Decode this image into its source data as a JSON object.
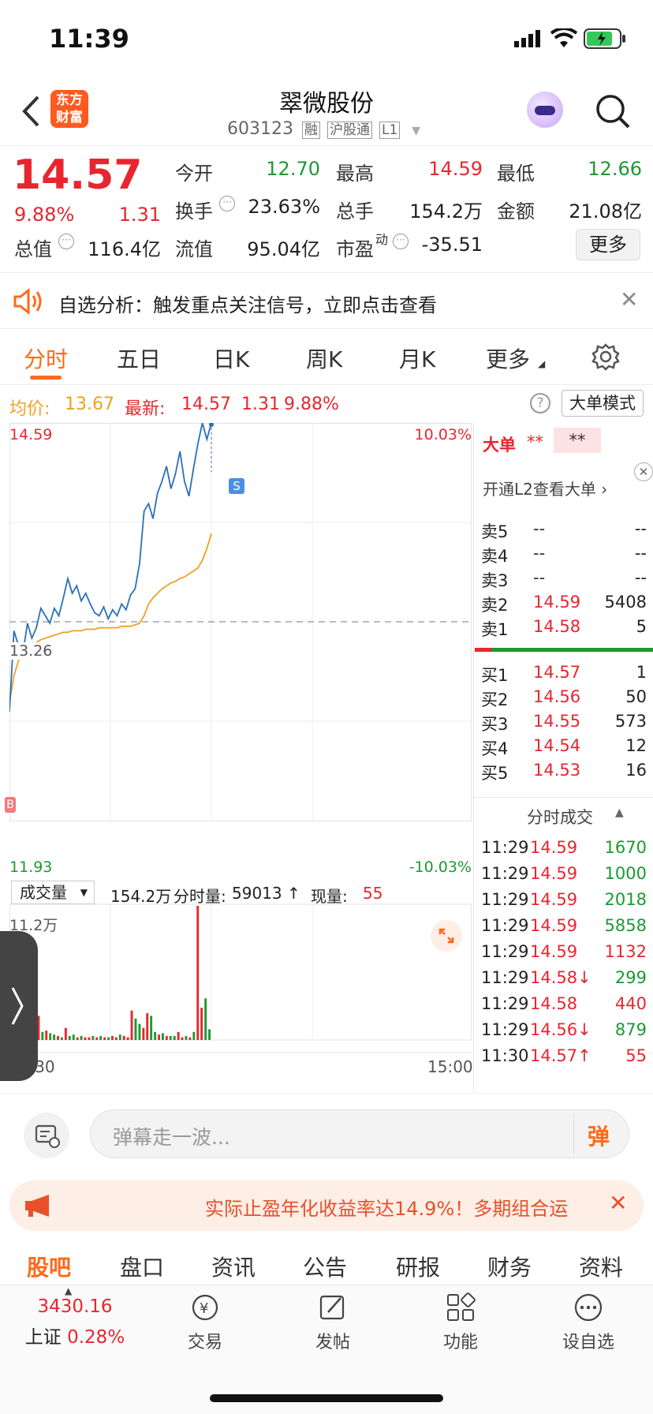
{
  "status": {
    "time": "11:39"
  },
  "nav": {
    "title": "翠微股份",
    "code": "603123",
    "tags": [
      "融",
      "沪股通",
      "L1"
    ],
    "logo_line1": "东方",
    "logo_line2": "财富"
  },
  "quote": {
    "price": "14.57",
    "pct": "9.88%",
    "chg": "1.31",
    "jinkai_label": "今开",
    "jinkai": "12.70",
    "zuigao_label": "最高",
    "zuigao": "14.59",
    "zuidi_label": "最低",
    "zuidi": "12.66",
    "huanshou_label": "换手",
    "huanshou": "23.63%",
    "zongshou_label": "总手",
    "zongshou": "154.2万",
    "jine_label": "金额",
    "jine": "21.08亿",
    "zongzhi_label": "总值",
    "zongzhi": "116.4亿",
    "liuzhi_label": "流值",
    "liuzhi": "95.04亿",
    "shiying_label": "市盈",
    "shiying_sup": "动",
    "shiying": "-35.51",
    "more_btn": "更多"
  },
  "alert": {
    "text": "自选分析：触发重点关注信号，立即点击查看"
  },
  "tabs": {
    "items": [
      "分时",
      "五日",
      "日K",
      "周K",
      "月K",
      "更多"
    ],
    "active": 0
  },
  "avgline": {
    "avg_label": "均价:",
    "avg": "13.67",
    "latest_label": "最新:",
    "latest": "14.57",
    "chg": "1.31",
    "pct": "9.88%",
    "mode_btn": "大单模式"
  },
  "chart_data": {
    "type": "line",
    "ylim": [
      11.93,
      14.59
    ],
    "y_top_label": "14.59",
    "y_bottom_label": "11.93",
    "y_mid_label": "13.26",
    "pct_top_label": "10.03%",
    "pct_bottom_label": "-10.03%",
    "x_start_label": "09:30",
    "x_end_label": "15:00",
    "s_marker": "S",
    "b_marker": "B",
    "series": [
      {
        "values": [
          12.66,
          13.2,
          13.1,
          13.05,
          13.25,
          13.15,
          13.22,
          13.35,
          13.3,
          13.25,
          13.35,
          13.3,
          13.42,
          13.55,
          13.45,
          13.5,
          13.4,
          13.45,
          13.38,
          13.32,
          13.3,
          13.36,
          13.28,
          13.34,
          13.3,
          13.38,
          13.34,
          13.44,
          13.48,
          13.65,
          14.0,
          14.05,
          13.95,
          14.12,
          14.2,
          14.3,
          14.15,
          14.25,
          14.4,
          14.2,
          14.1,
          14.28,
          14.45,
          14.59,
          14.48,
          14.59
        ]
      },
      {
        "values": [
          12.72,
          12.9,
          13.0,
          13.05,
          13.08,
          13.1,
          13.12,
          13.14,
          13.15,
          13.16,
          13.17,
          13.18,
          13.19,
          13.19,
          13.2,
          13.2,
          13.2,
          13.21,
          13.21,
          13.21,
          13.22,
          13.22,
          13.22,
          13.22,
          13.22,
          13.23,
          13.23,
          13.23,
          13.24,
          13.25,
          13.3,
          13.38,
          13.42,
          13.45,
          13.48,
          13.5,
          13.52,
          13.53,
          13.55,
          13.56,
          13.58,
          13.6,
          13.62,
          13.67,
          13.75,
          13.85
        ]
      }
    ],
    "volume": {
      "selector_label": "成交量",
      "total": "154.2万",
      "fenshi_label": "分时量:",
      "fenshi": "59013 ↑",
      "xian_label": "现量:",
      "xian": "55",
      "ymax_label": "11.2万",
      "values": [
        3,
        12,
        5,
        4,
        8,
        3,
        2,
        18,
        6,
        7,
        5,
        4,
        3,
        2,
        9,
        3,
        4,
        2,
        3,
        2,
        2,
        3,
        2,
        3,
        2,
        2,
        3,
        2,
        4,
        3,
        2,
        22,
        16,
        12,
        9,
        20,
        18,
        6,
        4,
        5,
        3,
        3,
        3,
        6,
        2,
        3,
        2,
        6,
        100,
        24,
        31,
        8
      ],
      "colors": [
        "red",
        "green",
        "green",
        "red",
        "green",
        "green",
        "green",
        "red",
        "green",
        "red",
        "green",
        "green",
        "red",
        "green",
        "red",
        "green",
        "green",
        "red",
        "green",
        "red",
        "red",
        "green",
        "red",
        "green",
        "red",
        "green",
        "red",
        "red",
        "green",
        "red",
        "red",
        "red",
        "green",
        "green",
        "red",
        "red",
        "green",
        "green",
        "red",
        "green",
        "red",
        "green",
        "green",
        "red",
        "red",
        "green",
        "red",
        "green",
        "red",
        "red",
        "green",
        "green"
      ]
    }
  },
  "orderbook": {
    "dadan_label": "大单",
    "dadan_val1": "**",
    "dadan_val2": "**",
    "l2_text": "开通L2查看大单 ›",
    "sell": [
      {
        "label": "卖5",
        "price": "--",
        "vol": "--"
      },
      {
        "label": "卖4",
        "price": "--",
        "vol": "--"
      },
      {
        "label": "卖3",
        "price": "--",
        "vol": "--"
      },
      {
        "label": "卖2",
        "price": "14.59",
        "vol": "5408"
      },
      {
        "label": "卖1",
        "price": "14.58",
        "vol": "5"
      }
    ],
    "buy": [
      {
        "label": "买1",
        "price": "14.57",
        "vol": "1"
      },
      {
        "label": "买2",
        "price": "14.56",
        "vol": "50"
      },
      {
        "label": "买3",
        "price": "14.55",
        "vol": "573"
      },
      {
        "label": "买4",
        "price": "14.54",
        "vol": "12"
      },
      {
        "label": "买5",
        "price": "14.53",
        "vol": "16"
      }
    ],
    "trades_title": "分时成交",
    "trades": [
      {
        "time": "11:29",
        "price": "14.59",
        "vol": "1670",
        "vcolor": "green"
      },
      {
        "time": "11:29",
        "price": "14.59",
        "vol": "1000",
        "vcolor": "green"
      },
      {
        "time": "11:29",
        "price": "14.59",
        "vol": "2018",
        "vcolor": "green"
      },
      {
        "time": "11:29",
        "price": "14.59",
        "vol": "5858",
        "vcolor": "green"
      },
      {
        "time": "11:29",
        "price": "14.59",
        "vol": "1132",
        "vcolor": "red"
      },
      {
        "time": "11:29",
        "price": "14.58↓",
        "vol": "299",
        "vcolor": "green"
      },
      {
        "time": "11:29",
        "price": "14.58",
        "vol": "440",
        "vcolor": "red"
      },
      {
        "time": "11:29",
        "price": "14.56↓",
        "vol": "879",
        "vcolor": "green"
      },
      {
        "time": "11:30",
        "price": "14.57↑",
        "vol": "55",
        "vcolor": "red"
      }
    ]
  },
  "chat": {
    "placeholder": "弹幕走一波...",
    "send_btn": "弹"
  },
  "banner": {
    "text": "实际止盈年化收益率达14.9%！多期组合运"
  },
  "subtabs": [
    "股吧",
    "盘口",
    "资讯",
    "公告",
    "研报",
    "财务",
    "资料"
  ],
  "tabbar": {
    "index_value": "3430.16",
    "index_name": "上证",
    "index_pct": "0.28%",
    "items": [
      "交易",
      "发帖",
      "功能",
      "设自选"
    ]
  },
  "colors": {
    "up": "#e8262f",
    "down": "#1a9a32",
    "avg": "#f0a020",
    "price_line": "#2c6fb8",
    "accent": "#ff6a1a"
  }
}
